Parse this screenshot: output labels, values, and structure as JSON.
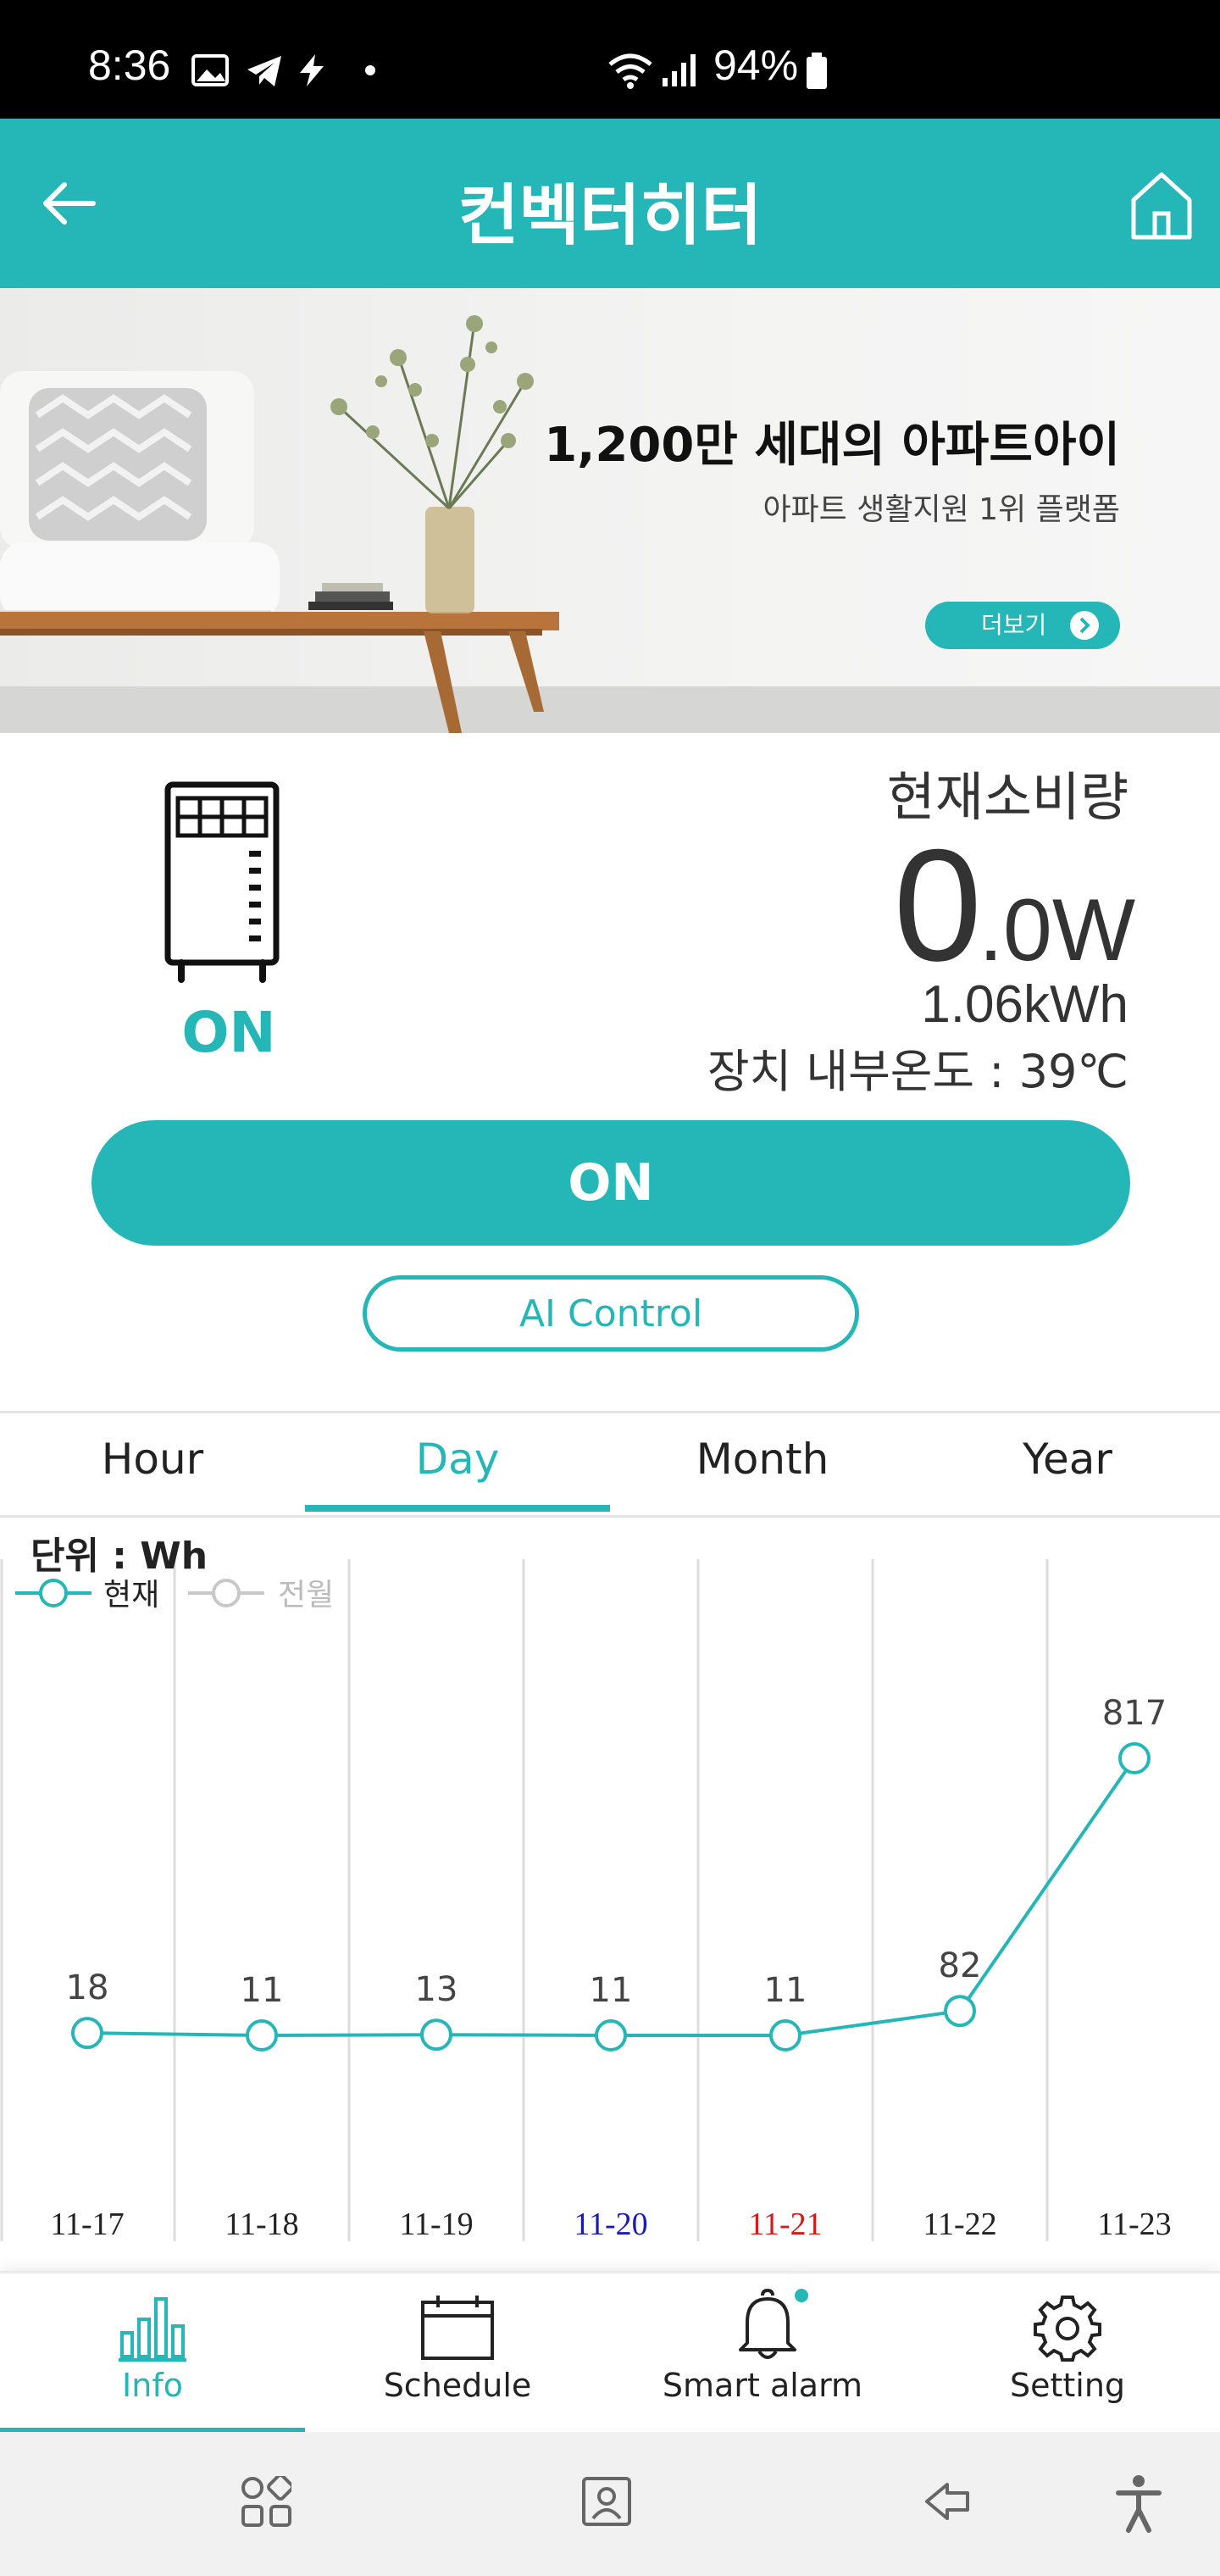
{
  "status_bar": {
    "time": "8:36",
    "battery": "94%"
  },
  "header": {
    "title": "컨벡터히터",
    "back_icon": "back-arrow-icon",
    "home_icon": "home-icon"
  },
  "banner": {
    "headline": "1,200만 세대의 아파트아이",
    "subline": "아파트 생활지원 1위 플랫폼",
    "more_label": "더보기"
  },
  "device": {
    "state_label": "ON",
    "consumption_label": "현재소비량",
    "power_big": "0",
    "power_small": ".0W",
    "energy": "1.06kWh",
    "internal_temp": "장치 내부온도 : 39℃",
    "power_button_label": "ON",
    "ai_button_label": "AI Control"
  },
  "tabs": [
    {
      "label": "Hour"
    },
    {
      "label": "Day",
      "active": true
    },
    {
      "label": "Month"
    },
    {
      "label": "Year"
    }
  ],
  "chart_data": {
    "type": "line",
    "unit_label": "단위 : Wh",
    "categories": [
      "11-17",
      "11-18",
      "11-19",
      "11-20",
      "11-21",
      "11-22",
      "11-23"
    ],
    "category_colors": [
      "#222222",
      "#222222",
      "#222222",
      "#1a1ab8",
      "#d41a1a",
      "#222222",
      "#222222"
    ],
    "series": [
      {
        "name": "현재",
        "values": [
          18,
          11,
          13,
          11,
          11,
          82,
          817
        ],
        "color": "#25b7b7"
      },
      {
        "name": "전월",
        "values": [],
        "color": "#c8c8c8"
      }
    ],
    "data_labels": [
      "18",
      "11",
      "13",
      "11",
      "11",
      "82",
      "817"
    ],
    "ylim": [
      0,
      1000
    ],
    "grid": "vertical"
  },
  "bottom_nav": [
    {
      "label": "Info",
      "icon": "bar-chart-icon",
      "active": true
    },
    {
      "label": "Schedule",
      "icon": "calendar-icon"
    },
    {
      "label": "Smart alarm",
      "icon": "bell-icon"
    },
    {
      "label": "Setting",
      "icon": "gear-icon"
    }
  ],
  "system_nav": {
    "icons": [
      "recent-apps-icon",
      "contacts-icon",
      "back-icon",
      "accessibility-icon"
    ]
  }
}
